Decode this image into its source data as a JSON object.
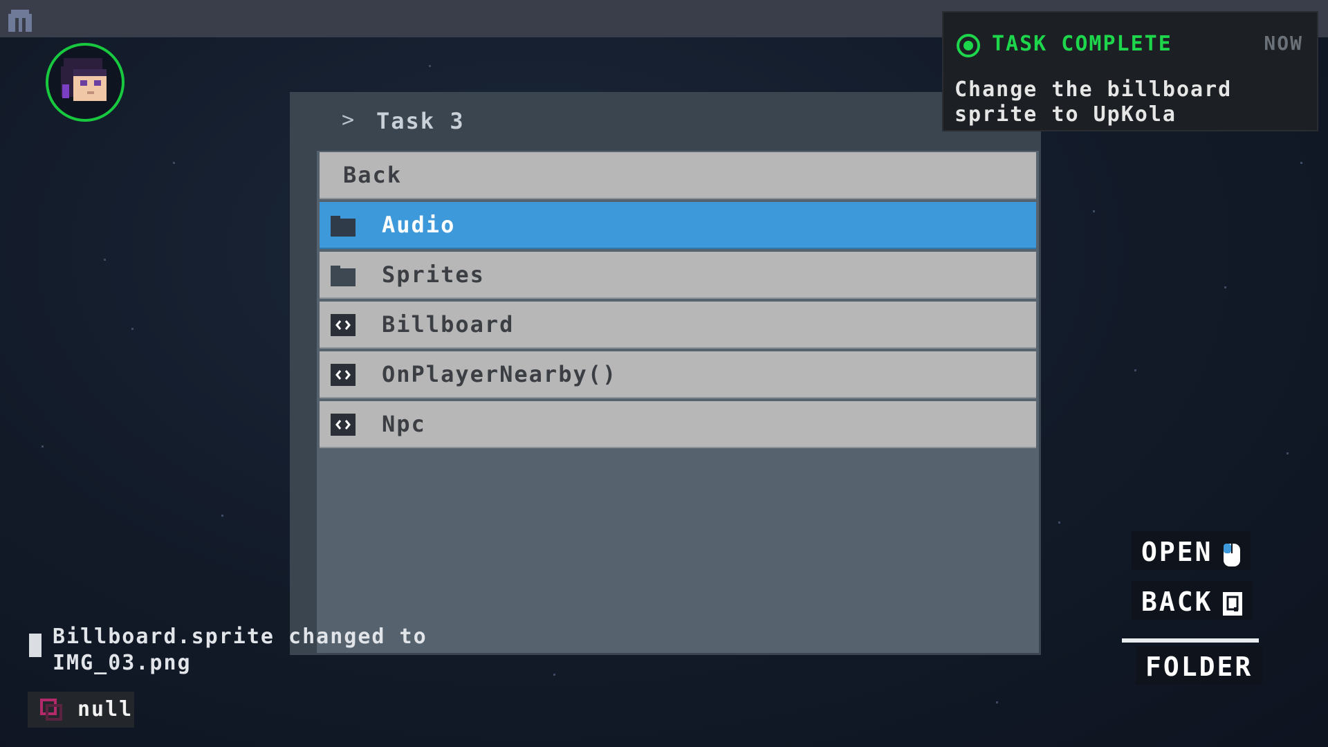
{
  "window": {
    "title": "Task 3",
    "items": [
      {
        "label": "Back",
        "kind": "back"
      },
      {
        "label": "Audio",
        "kind": "folder",
        "selected": true
      },
      {
        "label": "Sprites",
        "kind": "folder"
      },
      {
        "label": "Billboard",
        "kind": "script"
      },
      {
        "label": "OnPlayerNearby()",
        "kind": "script"
      },
      {
        "label": "Npc",
        "kind": "script"
      }
    ]
  },
  "toast": {
    "heading": "TASK COMPLETE",
    "time": "NOW",
    "body": "Change the billboard sprite to UpKola",
    "accent": "#1ed64b"
  },
  "controls": {
    "open_label": "OPEN",
    "back_label": "BACK",
    "folder_label": "FOLDER"
  },
  "log": {
    "message": "Billboard.sprite changed to IMG_03.png"
  },
  "status": {
    "value": "null"
  },
  "colors": {
    "selected_row": "#3d99da",
    "row": "#b7b7b7",
    "avatar_ring": "#18c940"
  }
}
